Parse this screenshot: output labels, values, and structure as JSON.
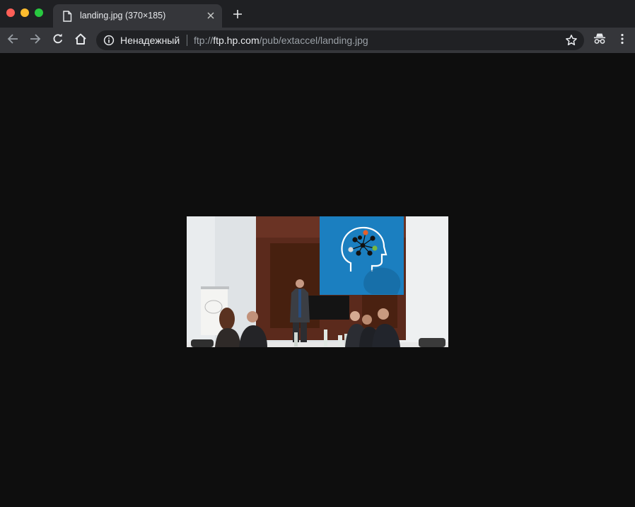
{
  "tab": {
    "title": "landing.jpg (370×185)"
  },
  "omnibox": {
    "security_label": "Ненадежный",
    "url_scheme": "ftp://",
    "url_host": "ftp.hp.com",
    "url_path": "/pub/extaccel/landing.jpg"
  },
  "icons": {
    "tab_favicon": "document-icon",
    "tab_close": "close-icon",
    "new_tab": "plus-icon",
    "back": "arrow-left-icon",
    "forward": "arrow-right-icon",
    "reload": "reload-icon",
    "home": "home-icon",
    "info": "info-icon",
    "bookmark": "star-icon",
    "incognito": "incognito-icon",
    "menu": "kebab-menu-icon"
  },
  "colors": {
    "tabstrip": "#1f2023",
    "toolbar": "#35363a",
    "omnibox": "#202124",
    "content_bg": "#0e0e0e",
    "hp_blue": "#1b7fc0"
  }
}
